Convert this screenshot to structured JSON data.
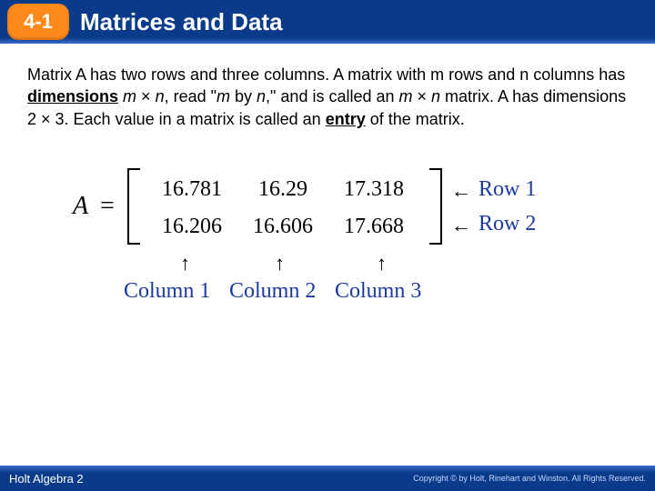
{
  "header": {
    "lesson": "4-1",
    "title": "Matrices and Data"
  },
  "body": {
    "p1a": "Matrix A has two rows and three columns. A matrix with m rows and n columns has ",
    "dim_word": "dimensions",
    "p1b": " ",
    "mvar": "m",
    "times1": " × ",
    "nvar1": "n",
    "p1c": ", read \"",
    "mvar2": "m",
    "p1d": " by ",
    "nvar2": "n",
    "p1e": ",\" and is called an ",
    "mvar3": "m",
    "times2": " × ",
    "nvar3": "n",
    "p1f": " matrix. A has dimensions 2 × 3. Each value in a matrix is called an ",
    "entry_word": "entry",
    "p1g": " of the matrix."
  },
  "figure": {
    "A": "A",
    "eq": "=",
    "row_arrow": "←",
    "col_arrow": "↑",
    "row1_label": "Row 1",
    "row2_label": "Row 2",
    "col1_label": "Column 1",
    "col2_label": "Column 2",
    "col3_label": "Column 3",
    "matrix": [
      [
        "16.781",
        "16.29",
        "17.318"
      ],
      [
        "16.206",
        "16.606",
        "17.668"
      ]
    ]
  },
  "footer": {
    "left": "Holt Algebra 2",
    "right": "Copyright © by Holt, Rinehart and Winston. All Rights Reserved."
  },
  "chart_data": {
    "type": "table",
    "name": "Matrix A",
    "dimensions": "2 × 3",
    "rows": 2,
    "cols": 3,
    "row_labels": [
      "Row 1",
      "Row 2"
    ],
    "col_labels": [
      "Column 1",
      "Column 2",
      "Column 3"
    ],
    "values": [
      [
        16.781,
        16.29,
        17.318
      ],
      [
        16.206,
        16.606,
        17.668
      ]
    ]
  }
}
